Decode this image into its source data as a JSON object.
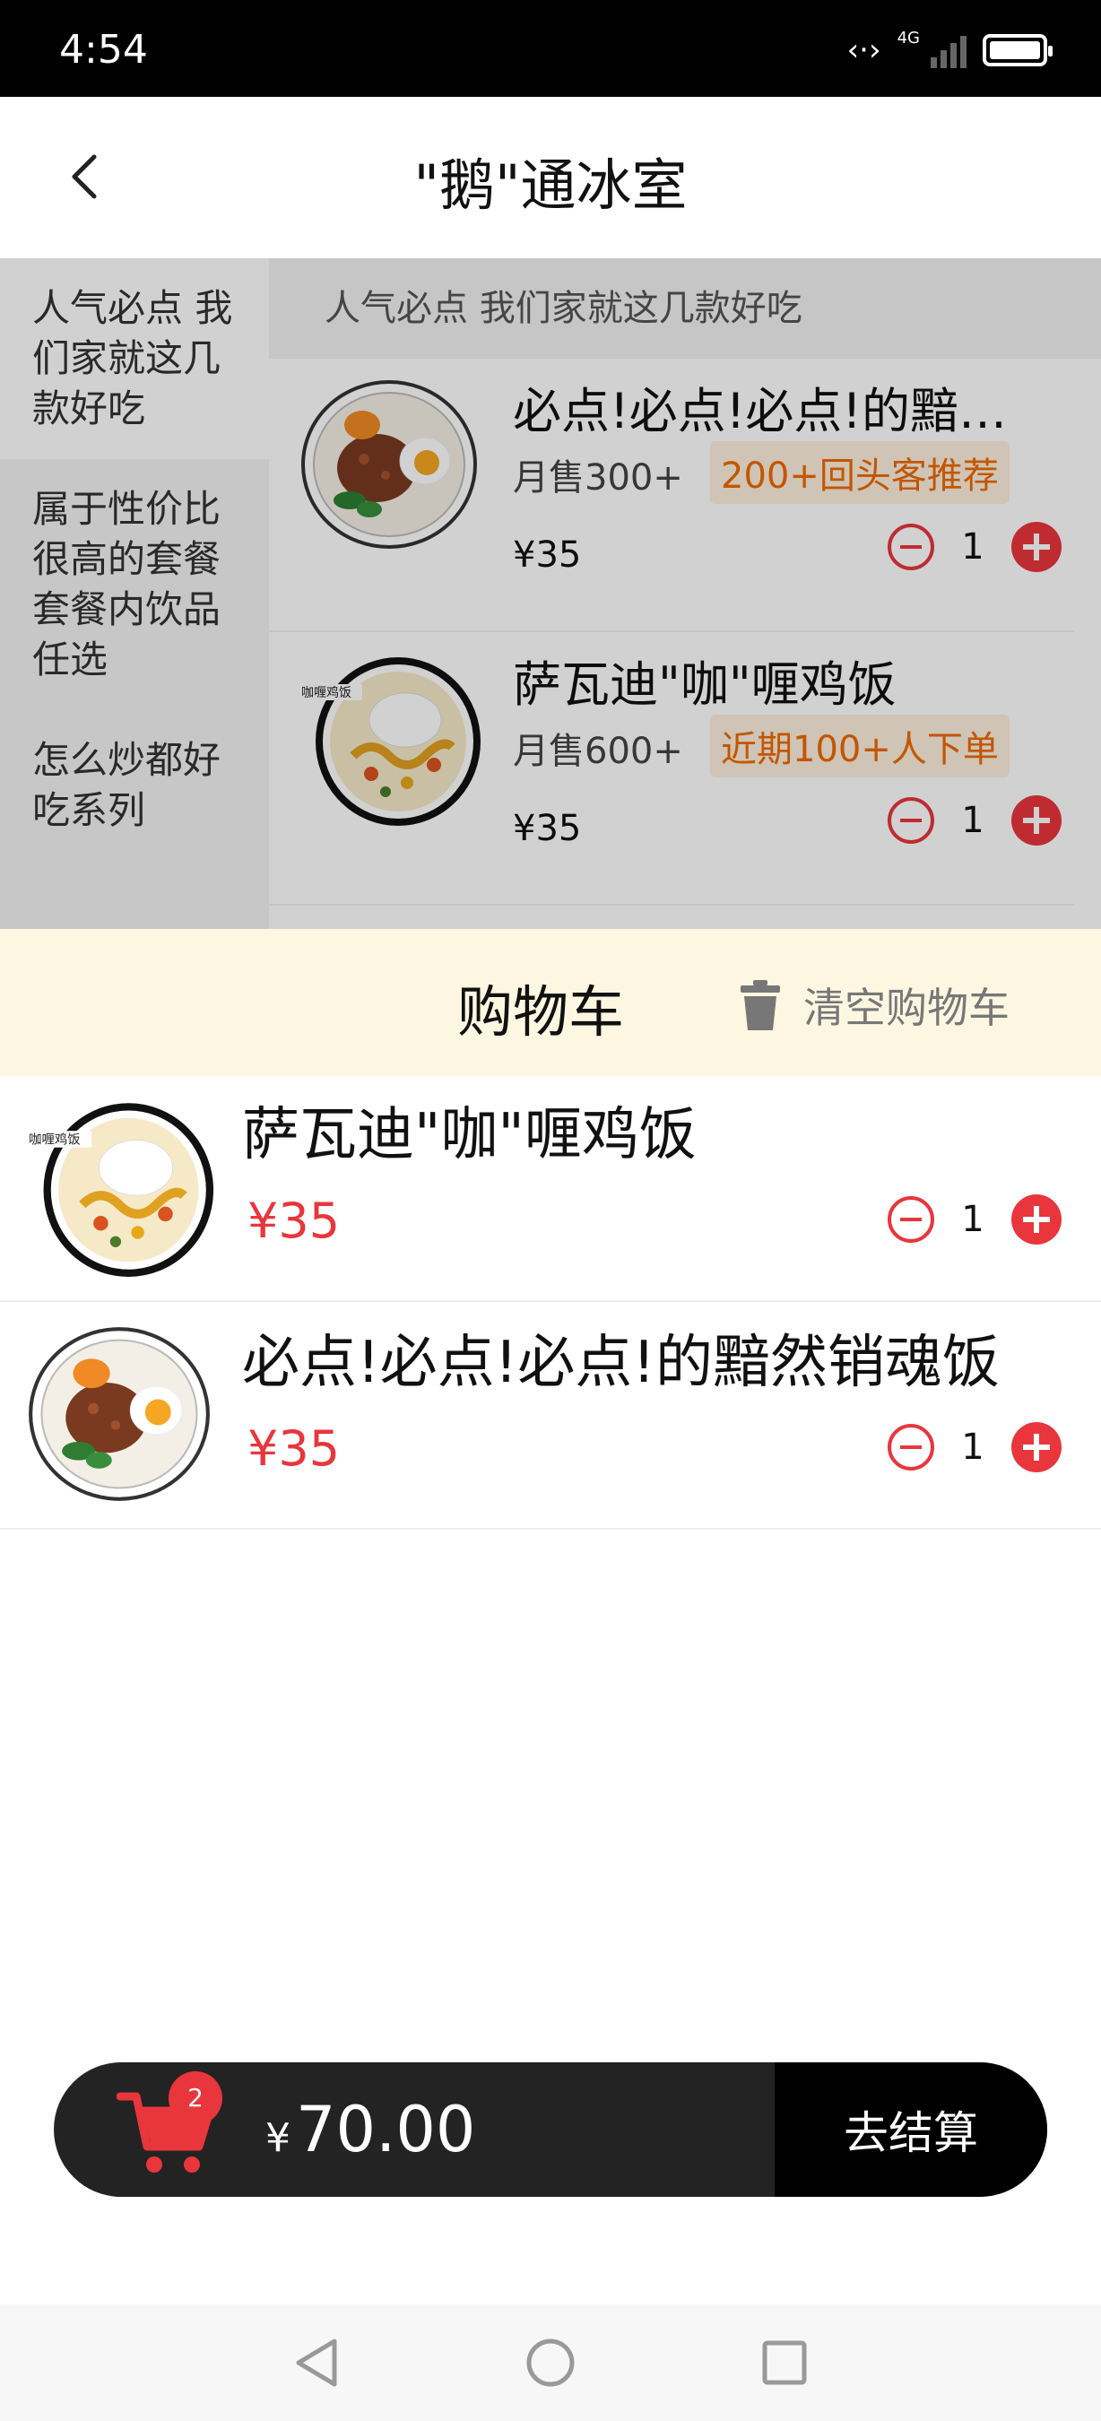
{
  "status": {
    "time": "4:54",
    "network_label": "4G"
  },
  "header": {
    "title": "\"鹅\"通冰室"
  },
  "categories": [
    {
      "label": "人气必点 我们家就这几款好吃"
    },
    {
      "label": "属于性价比很高的套餐 套餐内饮品任选"
    },
    {
      "label": "怎么炒都好吃系列"
    }
  ],
  "menu": {
    "section_title": "人气必点 我们家就这几款好吃",
    "items": [
      {
        "name": "必点!必点!必点!的黯然销魂饭",
        "sales": "月售300+",
        "badge": "200+回头客推荐",
        "price": "¥35",
        "qty": "1"
      },
      {
        "name": "萨瓦迪\"咖\"喱鸡饭",
        "sales": "月售600+",
        "badge": "近期100+人下单",
        "price": "¥35",
        "qty": "1"
      }
    ]
  },
  "cart": {
    "title": "购物车",
    "clear_label": "清空购物车",
    "items": [
      {
        "name": "萨瓦迪\"咖\"喱鸡饭",
        "price": "¥35",
        "qty": "1"
      },
      {
        "name": "必点!必点!必点!的黯然销魂饭",
        "price": "¥35",
        "qty": "1"
      }
    ]
  },
  "checkout": {
    "count": "2",
    "currency": "¥",
    "total": "70.00",
    "pay_label": "去结算"
  },
  "colors": {
    "accent": "#e8363c",
    "badge_text": "#ee6a00",
    "badge_bg": "#fdf0dd",
    "cart_header_bg": "#fdf7e2",
    "checkout_bg": "#232323"
  }
}
